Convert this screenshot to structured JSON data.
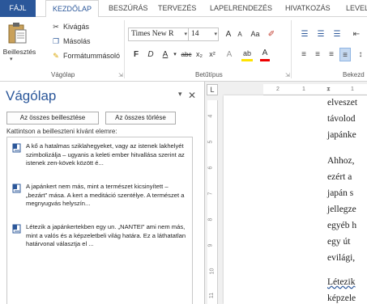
{
  "tabs": {
    "file": "FÁJL",
    "home": "KEZDŐLAP",
    "insert": "BESZÚRÁS",
    "design": "TERVEZÉS",
    "layout": "LAPELRENDEZÉS",
    "references": "HIVATKOZÁS",
    "mailings": "LEVEL"
  },
  "ribbon": {
    "clipboard": {
      "paste_label": "Beillesztés",
      "cut": "Kivágás",
      "copy": "Másolás",
      "format_painter": "Formátummásoló",
      "group_label": "Vágólap"
    },
    "font": {
      "font_name": "Times New R",
      "font_size": "14",
      "group_label": "Betűtípus",
      "bold": "F",
      "italic": "D",
      "underline": "A",
      "strike": "abc",
      "subscript": "x₂",
      "superscript": "x²",
      "grow": "A",
      "shrink": "A",
      "case": "Aa",
      "highlight": "ab",
      "color": "A"
    },
    "paragraph": {
      "group_label_partial": "Bekezd"
    }
  },
  "pane": {
    "title": "Vágólap",
    "close": "✕",
    "options": "▾",
    "paste_all": "Az összes beillesztése",
    "clear_all": "Az összes törlése",
    "hint": "Kattintson a beilleszteni kívánt elemre:",
    "items": [
      {
        "text": "A kő a hatalmas sziklahegyeket, vagy az istenek lakhelyét szimbolizálja – ugyanis a keleti ember hitvallása szerint az istenek zen-kövek között é..."
      },
      {
        "text": "A japánkert nem más, mint a természet kicsinyített – „bezárt” mása. A kert a meditáció szentélye. A természet a megnyugvás helyszín..."
      },
      {
        "text": "Létezik a japánkertekben egy un. „NANTEI” ami nem más, mint a valós és a képzeletbeli világ határa. Ez a láthatatlan határvonal választja el ..."
      }
    ]
  },
  "ruler": {
    "corner": "L",
    "h_ticks": [
      "2",
      "1",
      "1"
    ],
    "v_ticks": [
      "4",
      "5",
      "6",
      "7",
      "8",
      "9",
      "10",
      "11"
    ]
  },
  "document": {
    "lines": [
      "elveszet",
      "távolod",
      "japánke",
      "Ahhoz,",
      "ezért a",
      "japán s",
      "jellegze",
      "egyéb h",
      "egy út",
      "evilági,",
      "Létezik",
      "képzele"
    ]
  },
  "colors": {
    "accent": "#2b579a",
    "file_tab": "#2b579a"
  }
}
